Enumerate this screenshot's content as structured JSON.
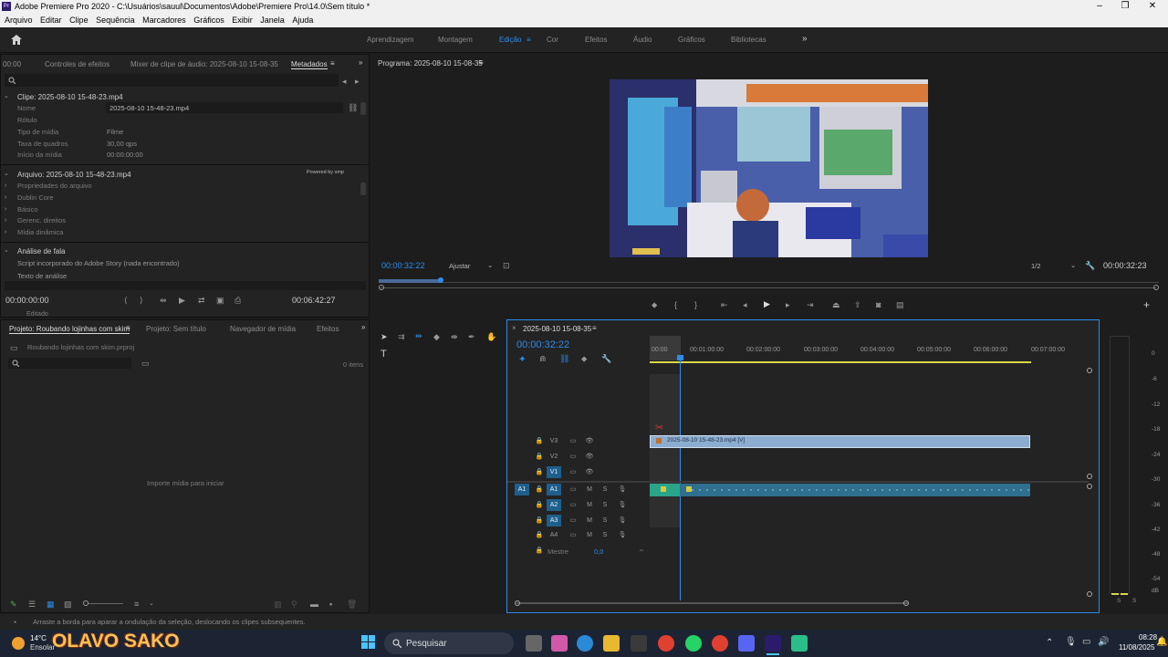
{
  "window": {
    "title": "Adobe Premiere Pro 2020 - C:\\Usuários\\sauul\\Documentos\\Adobe\\Premiere Pro\\14.0\\Sem título *",
    "app_icon": "Pr"
  },
  "menu": [
    "Arquivo",
    "Editar",
    "Clipe",
    "Sequência",
    "Marcadores",
    "Gráficos",
    "Exibir",
    "Janela",
    "Ajuda"
  ],
  "workspaces": [
    "Aprendizagem",
    "Montagem",
    "Edição",
    "Cor",
    "Efeitos",
    "Áudio",
    "Gráficos",
    "Bibliotecas"
  ],
  "active_workspace": "Edição",
  "source_panel": {
    "tabs": [
      "00:00",
      "Controles de efeitos",
      "Mixer de clipe de áudio: 2025-08-10 15-08-35",
      "Metadados"
    ],
    "clip_header": "Clipe: 2025-08-10 15-48-23.mp4",
    "clip_rows": [
      {
        "label": "Nome",
        "value": "2025-08-10 15-48-23.mp4"
      },
      {
        "label": "Rótulo",
        "value": ""
      },
      {
        "label": "Tipo de mídia",
        "value": "Filme"
      },
      {
        "label": "Taxa de quadros",
        "value": "30,00 qps"
      },
      {
        "label": "Início da mídia",
        "value": "00:00:00:00"
      }
    ],
    "file_header": "Arquivo: 2025-08-10 15-48-23.mp4",
    "xmp_badge": "Powered by xmp",
    "file_rows": [
      "Propriedades do arquivo",
      "Dublin Core",
      "Básico",
      "Gerenc. direitos",
      "Mídia dinâmica"
    ],
    "speech_header": "Análise de fala",
    "speech_rows": [
      "Script incorporado do Adobe Story (nada encontrado)",
      "Texto de análise"
    ],
    "timecode_left": "00:00:00:00",
    "timecode_right": "00:06:42:27",
    "cut_label": "Editado"
  },
  "program_monitor": {
    "title": "Programa: 2025-08-10 15-08-35",
    "timecode": "00:00:32:22",
    "fit": "Ajustar",
    "resolution": "1/2",
    "duration": "00:00:32:23"
  },
  "project_panel": {
    "tabs": [
      "Projeto: Roubando lojinhas com skim",
      "Projeto: Sem título",
      "Navegador de mídia",
      "Efeitos"
    ],
    "file": "Roubando lojinhas com skim.prproj",
    "items_count": "0 itens",
    "empty_text": "Importe mídia para iniciar"
  },
  "timeline": {
    "sequence_tab": "2025-08-10 15-08-35",
    "timecode": "00:00:32:22",
    "ruler": [
      "00:00",
      "00:01:00:00",
      "00:02:00:00",
      "00:03:00:00",
      "00:04:00:00",
      "00:05:00:00",
      "00:06:00:00",
      "00:07:00:00"
    ],
    "video_tracks": [
      "V3",
      "V2",
      "V1"
    ],
    "audio_tracks": [
      "A1",
      "A2",
      "A3",
      "A4"
    ],
    "source_patch": "A1",
    "master_label": "Mestre",
    "master_value": "0,0",
    "video_clip": "2025-08-10 15-48-23.mp4 [V]",
    "mute_label": "M",
    "solo_label": "S"
  },
  "audio_meter": {
    "scale": [
      "0",
      "-6",
      "-12",
      "-18",
      "-24",
      "-30",
      "-36",
      "-42",
      "-48",
      "-54",
      "dB"
    ],
    "solo_labels": [
      "S",
      "S"
    ]
  },
  "status_bar": "Arraste a borda para aparar a ondulação da seleção, deslocando os clipes subsequentes.",
  "taskbar": {
    "weather_temp": "14°C",
    "weather_desc": "Ensolar",
    "watermark": "OLAVO SAKO",
    "search": "Pesquisar",
    "time": "08:28",
    "date": "11/08/2025"
  },
  "colors": {
    "accent": "#2d8ceb",
    "video_clip": "#8cacd0",
    "audio_clip": "#2e8b8b",
    "panel_bg": "#232323",
    "taskbar": "#1c2433"
  }
}
